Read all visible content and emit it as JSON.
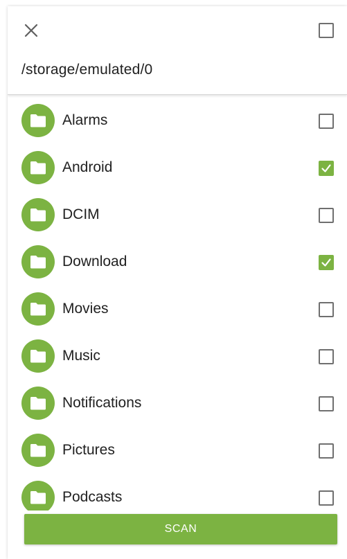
{
  "header": {
    "close_icon": "close-icon",
    "select_all_checked": false,
    "path": "/storage/emulated/0"
  },
  "folders": [
    {
      "name": "Alarms",
      "checked": false,
      "icon": "folder-icon"
    },
    {
      "name": "Android",
      "checked": true,
      "icon": "folder-icon"
    },
    {
      "name": "DCIM",
      "checked": false,
      "icon": "folder-icon"
    },
    {
      "name": "Download",
      "checked": true,
      "icon": "folder-icon"
    },
    {
      "name": "Movies",
      "checked": false,
      "icon": "folder-icon"
    },
    {
      "name": "Music",
      "checked": false,
      "icon": "folder-icon"
    },
    {
      "name": "Notifications",
      "checked": false,
      "icon": "folder-icon"
    },
    {
      "name": "Pictures",
      "checked": false,
      "icon": "folder-icon"
    },
    {
      "name": "Podcasts",
      "checked": false,
      "icon": "folder-icon"
    }
  ],
  "footer": {
    "scan_label": "SCAN"
  },
  "colors": {
    "accent": "#7cb342",
    "checkbox_border": "#6f6f6f",
    "text": "#212121"
  }
}
